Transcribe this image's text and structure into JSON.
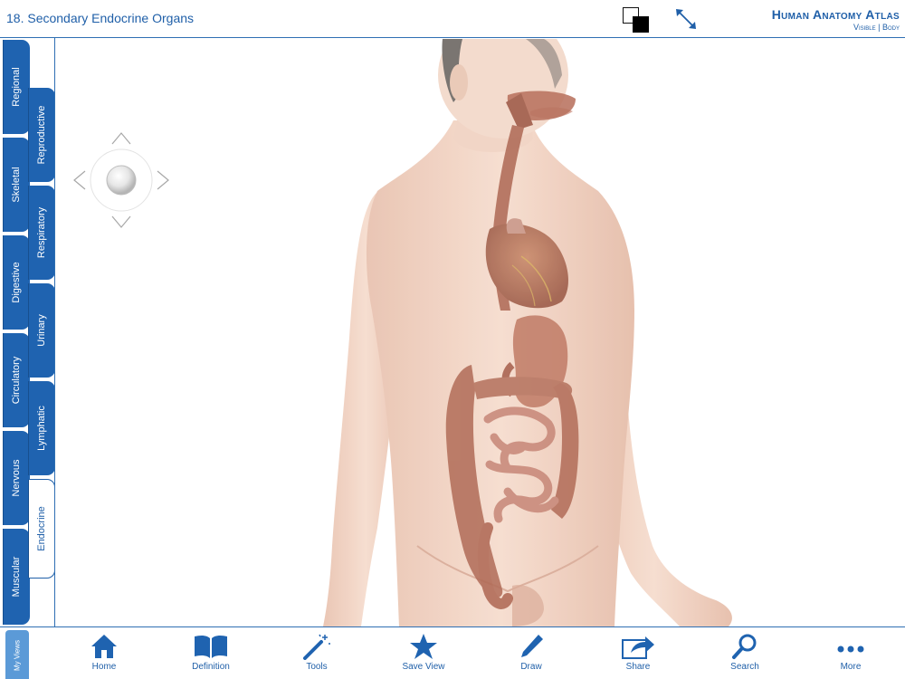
{
  "header": {
    "title": "18. Secondary Endocrine Organs",
    "brand_title": "Human Anatomy Atlas",
    "brand_sub": "Visible | Body",
    "color_toggle_icon": "background-color-toggle-icon",
    "expand_icon": "expand-arrows-icon"
  },
  "sidebar": {
    "outer_tabs": [
      {
        "label": "Regional"
      },
      {
        "label": "Skeletal"
      },
      {
        "label": "Digestive"
      },
      {
        "label": "Circulatory"
      },
      {
        "label": "Nervous"
      },
      {
        "label": "Muscular"
      }
    ],
    "inner_tabs": [
      {
        "label": "Reproductive"
      },
      {
        "label": "Respiratory"
      },
      {
        "label": "Urinary"
      },
      {
        "label": "Lymphatic"
      },
      {
        "label": "Endocrine",
        "active": true
      }
    ],
    "my_views_label": "My Views"
  },
  "toolbar": {
    "items": [
      {
        "label": "Home",
        "icon": "home-icon"
      },
      {
        "label": "Definition",
        "icon": "book-icon"
      },
      {
        "label": "Tools",
        "icon": "magic-wand-icon"
      },
      {
        "label": "Save View",
        "icon": "star-icon"
      },
      {
        "label": "Draw",
        "icon": "pencil-icon"
      },
      {
        "label": "Share",
        "icon": "share-arrow-icon"
      },
      {
        "label": "Search",
        "icon": "magnifier-icon"
      },
      {
        "label": "More",
        "icon": "ellipsis-icon"
      }
    ]
  },
  "colors": {
    "accent": "#1f63b0",
    "text_blue": "#1f5fa8",
    "my_views": "#5b9ad7",
    "skin": "#f1d4c4",
    "organ": "#b67362"
  }
}
